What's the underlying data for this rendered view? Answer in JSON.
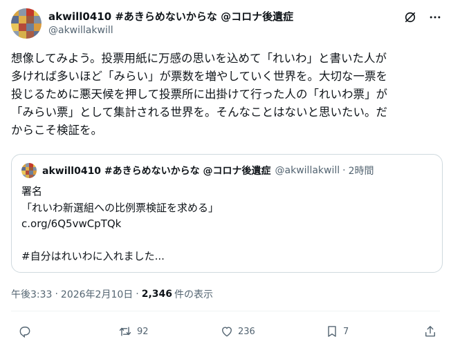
{
  "author": {
    "display_name": "akwill0410 #あきらめないからな @コロナ後遺症",
    "handle": "@akwillakwill",
    "avatar_colors": [
      "#d9a441",
      "#8a97a8",
      "#c23a2b",
      "#e6c14f",
      "#5b6c8f",
      "#e0b04a",
      "#9a5b3f",
      "#7f8ea3",
      "#e8c65a",
      "#b44a3a",
      "#6d7f99",
      "#d99a3c",
      "#8d9cb0",
      "#d6b04b",
      "#a95d45",
      "#5f7191"
    ]
  },
  "header_icons": [
    "grok-icon",
    "more-icon"
  ],
  "body_lines": [
    "想像してみよう。投票用紙に万感の思いを込めて「れいわ」と書いた人が",
    "多ければ多いほど「みらい」が票数を増やしていく世界を。大切な一票を",
    "投じるために悪天候を押して投票所に出掛けて行った人の「れいわ票」が",
    "「みらい票」として集計される世界を。そんなことはないと思いたい。だ",
    "からこそ検証を。"
  ],
  "quote": {
    "display_name": "akwill0410 #あきらめないからな @コロナ後遺症",
    "handle": "@akwillakwill",
    "time": "2時間",
    "lines": [
      "署名",
      "「れいわ新選組への比例票検証を求める」",
      "c.org/6Q5vwCpTQk",
      "",
      "#自分はれいわに入れました..."
    ]
  },
  "meta": {
    "time": "午後3:33",
    "date": "2026年2月10日",
    "views_count": "2,346",
    "views_label": "件の表示"
  },
  "actions": {
    "reply_count": "",
    "retweet_count": "92",
    "like_count": "236",
    "bookmark_count": "7"
  }
}
